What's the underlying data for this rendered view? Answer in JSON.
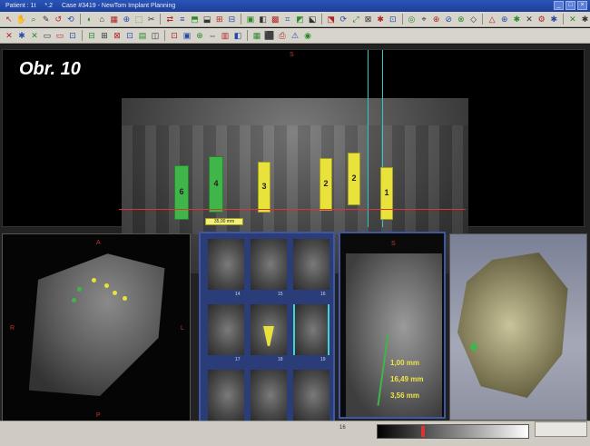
{
  "window": {
    "title_parts": [
      "Patient : 1t",
      "*.2",
      "Case #3419 - NewTom Implant Planning"
    ],
    "buttons": [
      "_",
      "□",
      "×"
    ]
  },
  "toolbar_row1": [
    "↖",
    "✋",
    "⌕",
    "✎",
    "↺",
    "⟲",
    "◐",
    "⌂",
    "▦",
    "⊕",
    "⬚",
    "✂",
    "⇄",
    "≡",
    "⬒",
    "⬓",
    "⊞",
    "⊟",
    "▣",
    "◧",
    "▩",
    "⌗",
    "◩",
    "⬕",
    "⬔",
    "⟳",
    "⤢",
    "⊠",
    "✱",
    "⊡",
    "◎",
    "⌖",
    "⊕",
    "⊘",
    "⊗",
    "◇",
    "△",
    "⊕",
    "✱",
    "✕",
    "⚙",
    "✱",
    "✕",
    "✱"
  ],
  "toolbar_row2": [
    "✕",
    "✱",
    "✕",
    "▭",
    "▭",
    "⊡",
    "⊟",
    "⊞",
    "⊠",
    "⊡",
    "▤",
    "◫",
    "⊡",
    "▣",
    "⊕",
    "⇔",
    "▥",
    "◧",
    "▦",
    "⬛",
    "⎙",
    "⚠",
    "◉"
  ],
  "figure_label": "Obr. 10",
  "panorama": {
    "orientation": {
      "top": "S",
      "left": "R",
      "right": "L"
    },
    "implants": [
      {
        "color": "#3fb54a",
        "num": "6"
      },
      {
        "color": "#3fb54a",
        "num": "4"
      },
      {
        "color": "#e8e23a",
        "num": "3"
      },
      {
        "color": "#e8e23a",
        "num": "2"
      },
      {
        "color": "#e8e23a",
        "num": "2"
      },
      {
        "color": "#e8e23a",
        "num": "1"
      }
    ],
    "measurement_tag": "35,00 mm"
  },
  "axial": {
    "orientation": {
      "top": "A",
      "left": "R",
      "right": "L",
      "bottom": "P"
    }
  },
  "slices": {
    "rows": [
      [
        "14",
        "15",
        "16"
      ],
      [
        "17",
        "18",
        "19"
      ],
      [
        "20",
        "21",
        "22"
      ]
    ],
    "highlight": "#3fd4d4",
    "implant_color": "#e8e23a"
  },
  "cross_section": {
    "measurements": [
      "1,00 mm",
      "16,49 mm",
      "3,56 mm"
    ],
    "bottom_label": "16",
    "orientation": {
      "top": "S",
      "left": "B",
      "right": "L"
    }
  },
  "colors": {
    "accent": "#3e57a6",
    "implant_green": "#3fb54a",
    "implant_yellow": "#e8e23a",
    "guide_line": "#d33333",
    "cyan": "#2cc9c9"
  }
}
